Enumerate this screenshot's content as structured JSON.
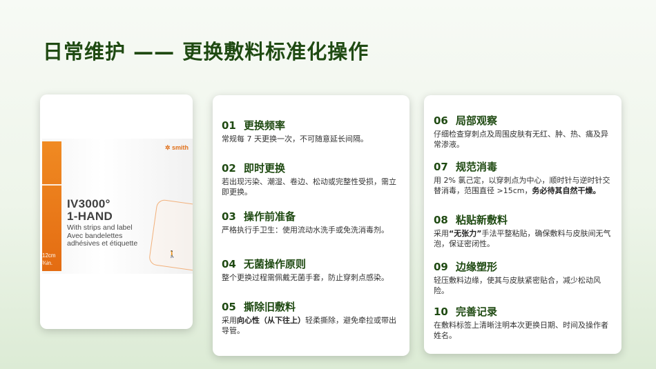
{
  "title": "日常维护 —— 更换敷料标准化操作",
  "product": {
    "brand": "smith",
    "name_line1": "IV3000°",
    "name_line2": "1-HAND",
    "desc1": "With strips and label",
    "desc2": "Avec bandelettes",
    "desc3": "adhésives et étiquette",
    "size1": "12cm",
    "size2": "¾in."
  },
  "items": [
    {
      "num": "01",
      "title": "更换频率",
      "body1": "常规每 7 天更换一次，不可随意延长间隔。",
      "body2": "",
      "body3": ""
    },
    {
      "num": "02",
      "title": "即时更换",
      "body1": "若出现污染、潮湿、卷边、松动或完整性受损，需立即更换。",
      "body2": "",
      "body3": ""
    },
    {
      "num": "03",
      "title": "操作前准备",
      "body1": "严格执行手卫生：使用流动水洗手或免洗消毒剂。",
      "body2": "",
      "body3": ""
    },
    {
      "num": "04",
      "title": "无菌操作原则",
      "body1": "整个更换过程需佩戴无菌手套，防止穿刺点感染。",
      "body2": "",
      "body3": ""
    },
    {
      "num": "05",
      "title": "撕除旧敷料",
      "body1": "采用",
      "body2": "向心性（从下往上）",
      "body3": "轻柔撕除，避免牵拉或带出导管。"
    },
    {
      "num": "06",
      "title": "局部观察",
      "body1": "仔细检查穿刺点及周围皮肤有无红、肿、热、痛及异常渗液。",
      "body2": "",
      "body3": ""
    },
    {
      "num": "07",
      "title": "规范消毒",
      "body1": "用 2% 氯己定，以穿刺点为中心，顺时针与逆时针交替消毒，范围直径 >15cm，",
      "body2": "务必待其自然干燥。",
      "body3": ""
    },
    {
      "num": "08",
      "title": "粘贴新敷料",
      "body1": "采用",
      "body2": "“无张力”",
      "body3": "手法平整粘贴，确保敷料与皮肤间无气泡，保证密闭性。"
    },
    {
      "num": "09",
      "title": "边缘塑形",
      "body1": "轻压敷料边缘，使其与皮肤紧密贴合，减少松动风险。",
      "body2": "",
      "body3": ""
    },
    {
      "num": "10",
      "title": "完善记录",
      "body1": "在敷料标签上清晰注明本次更换日期、时间及操作者姓名。",
      "body2": "",
      "body3": ""
    }
  ]
}
